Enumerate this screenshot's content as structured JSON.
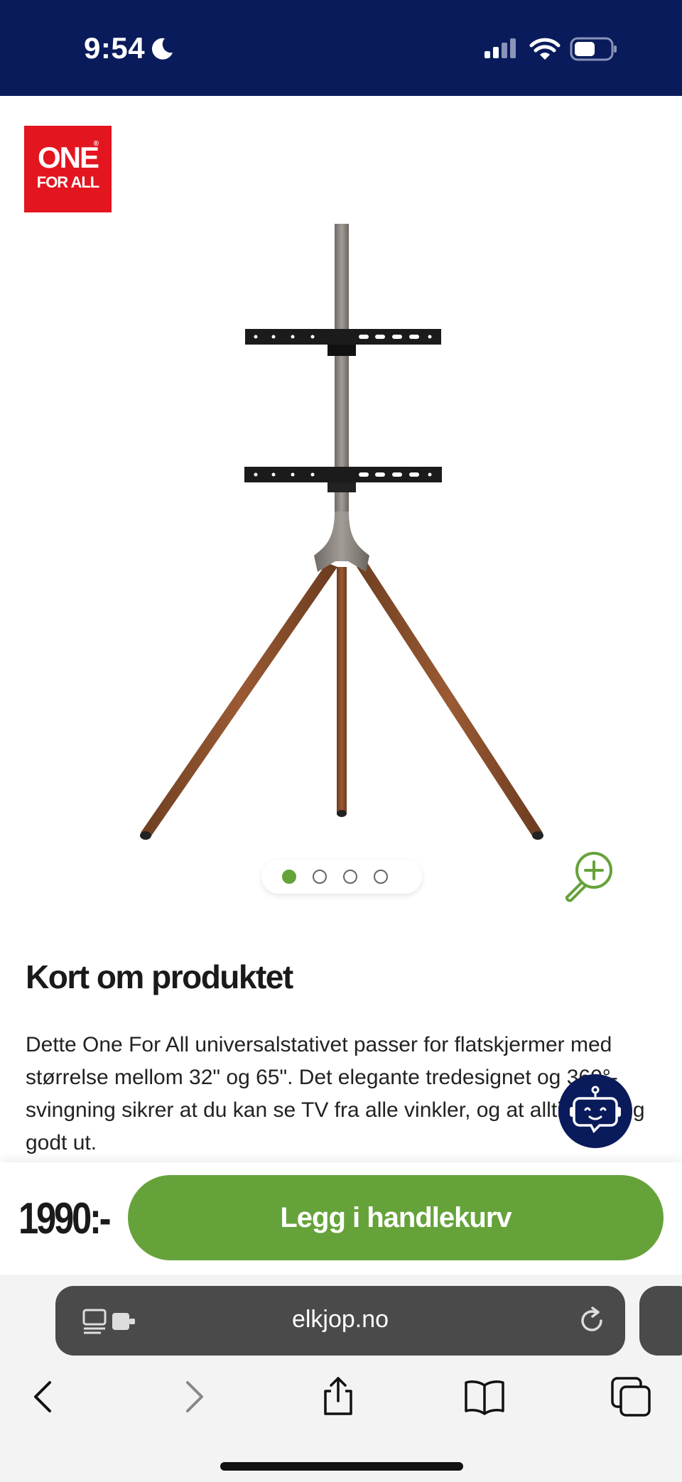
{
  "status_bar": {
    "time": "9:54",
    "background": "#0a1b5c"
  },
  "brand": {
    "line1": "ONE",
    "line2": "FOR ALL",
    "registered": "®",
    "color": "#e3151f"
  },
  "carousel": {
    "total": 4,
    "active_index": 0
  },
  "section": {
    "title": "Kort om produktet",
    "description": "Dette One For All universalstativet passer for flatskjermer med størrelse mellom 32\" og 65\". Det elegante tredesignet og 360°-svingning sikrer at du kan se TV fra alle vinkler, og at alltid tar seg godt ut."
  },
  "buy_bar": {
    "price": "1990:-",
    "cart_button": "Legg i handlekurv",
    "accent": "#66a23a"
  },
  "browser": {
    "url": "elkjop.no"
  },
  "icons": [
    "moon-icon",
    "signal-icon",
    "wifi-icon",
    "battery-icon",
    "zoom-in-icon",
    "chatbot-icon",
    "reader-icon",
    "reload-icon",
    "back-icon",
    "forward-icon",
    "share-icon",
    "bookmarks-icon",
    "tabs-icon"
  ]
}
